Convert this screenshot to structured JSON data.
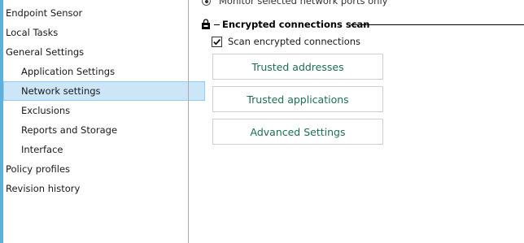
{
  "sidebar": {
    "items": [
      {
        "label": "Endpoint Sensor",
        "level": "top"
      },
      {
        "label": "Local Tasks",
        "level": "top"
      },
      {
        "label": "General Settings",
        "level": "top"
      },
      {
        "label": "Application Settings",
        "level": "sub"
      },
      {
        "label": "Network settings",
        "level": "sub",
        "selected": true
      },
      {
        "label": "Exclusions",
        "level": "sub"
      },
      {
        "label": "Reports and Storage",
        "level": "sub"
      },
      {
        "label": "Interface",
        "level": "sub"
      },
      {
        "label": "Policy profiles",
        "level": "top"
      },
      {
        "label": "Revision history",
        "level": "top"
      }
    ]
  },
  "main": {
    "radio_label": "Monitor selected network ports only",
    "encrypted_section": {
      "title": "Encrypted connections scan",
      "checkbox_label": "Scan encrypted connections",
      "checkbox_checked": true,
      "buttons": {
        "trusted_addresses": "Trusted addresses",
        "trusted_applications": "Trusted applications",
        "advanced_settings": "Advanced Settings"
      }
    }
  },
  "colors": {
    "selection_bg": "#cde6f7",
    "selection_border": "#9ccbeb",
    "button_text": "#1e6e52",
    "left_strip": "#5fb0d8"
  }
}
